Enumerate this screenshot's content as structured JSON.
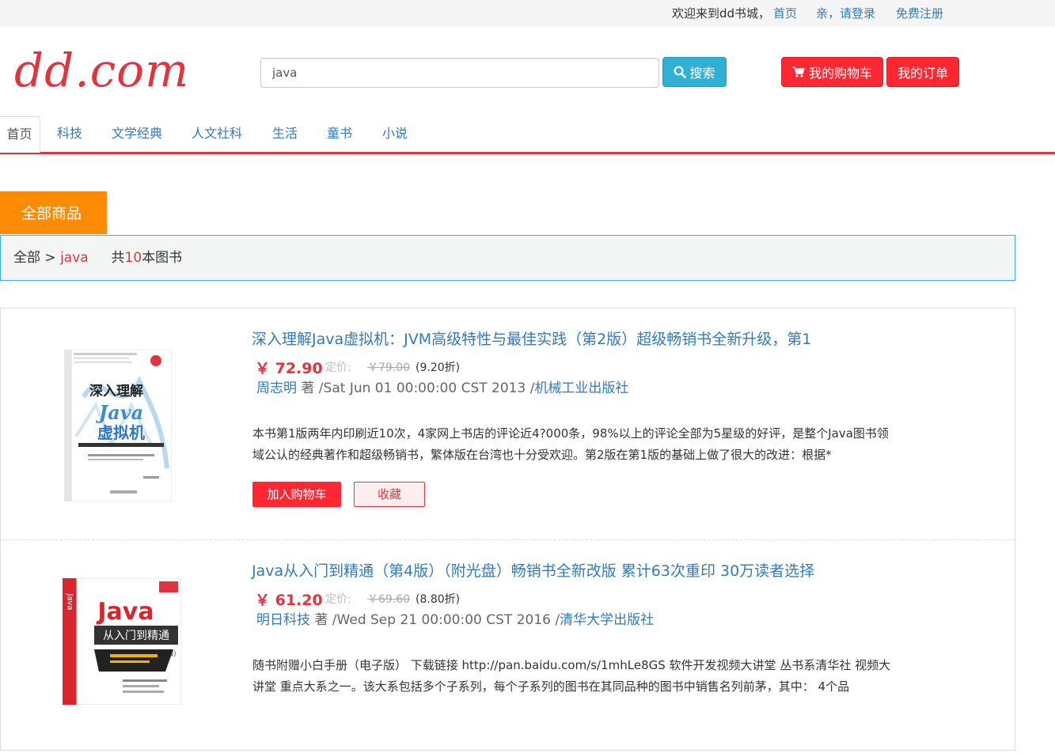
{
  "topbar": {
    "welcome": "欢迎来到dd书城，",
    "home": "首页",
    "login": "亲，请登录",
    "register": "免费注册"
  },
  "header": {
    "logo": "dd.com",
    "search_value": "java",
    "search_button": "搜索",
    "cart_button": "我的购物车",
    "orders_button": "我的订单"
  },
  "nav": {
    "tabs": [
      "首页",
      "科技",
      "文学经典",
      "人文社科",
      "生活",
      "童书",
      "小说"
    ],
    "active": "首页"
  },
  "section": {
    "title": "全部商品"
  },
  "breadcrumb": {
    "root": "全部",
    "sep": ">",
    "keyword": "java",
    "count_prefix": "共",
    "count": "10",
    "count_suffix": "本图书"
  },
  "products": [
    {
      "title": "深入理解Java虚拟机：JVM高级特性与最佳实践（第2版）超级畅销书全新升级，第1",
      "price": "￥ 72.90",
      "list_label": "定价:",
      "list_price": "￥79.00",
      "discount": "(9.20折)",
      "author": "周志明",
      "author_suffix": " 著 /",
      "date": "Sat Jun 01 00:00:00 CST 2013 /",
      "publisher": "机械工业出版社",
      "description": "本书第1版两年内印刷近10次，4家网上书店的评论近4?000条，98%以上的评论全部为5星级的好评，是整个Java图书领域公认的经典著作和超级畅销书，繁体版在台湾也十分受欢迎。第2版在第1版的基础上做了很大的改进：根据*",
      "cover_title": "深入理解",
      "cover_big": "Java",
      "cover_sub": "虚拟机",
      "add_cart": "加入购物车",
      "favorite": "收藏"
    },
    {
      "title": "Java从入门到精通（第4版）（附光盘）畅销书全新改版 累计63次重印 30万读者选择",
      "price": "￥ 61.20",
      "list_label": "定价:",
      "list_price": "￥69.60",
      "discount": "(8.80折)",
      "author": "明日科技",
      "author_suffix": " 著 /",
      "date": "Wed Sep 21 00:00:00 CST 2016 /",
      "publisher": "清华大学出版社",
      "description": "随书附赠小白手册（电子版） 下载链接 http://pan.baidu.com/s/1mhLe8GS 软件开发视频大讲堂 丛书系清华社 视频大讲堂 重点大系之一。该大系包括多个子系列，每个子系列的图书在其同品种的图书中销售名列前茅，其中： 4个品",
      "cover_big": "Java",
      "cover_sub": "从入门到精通",
      "cover_edition": "（第4版）"
    }
  ]
}
